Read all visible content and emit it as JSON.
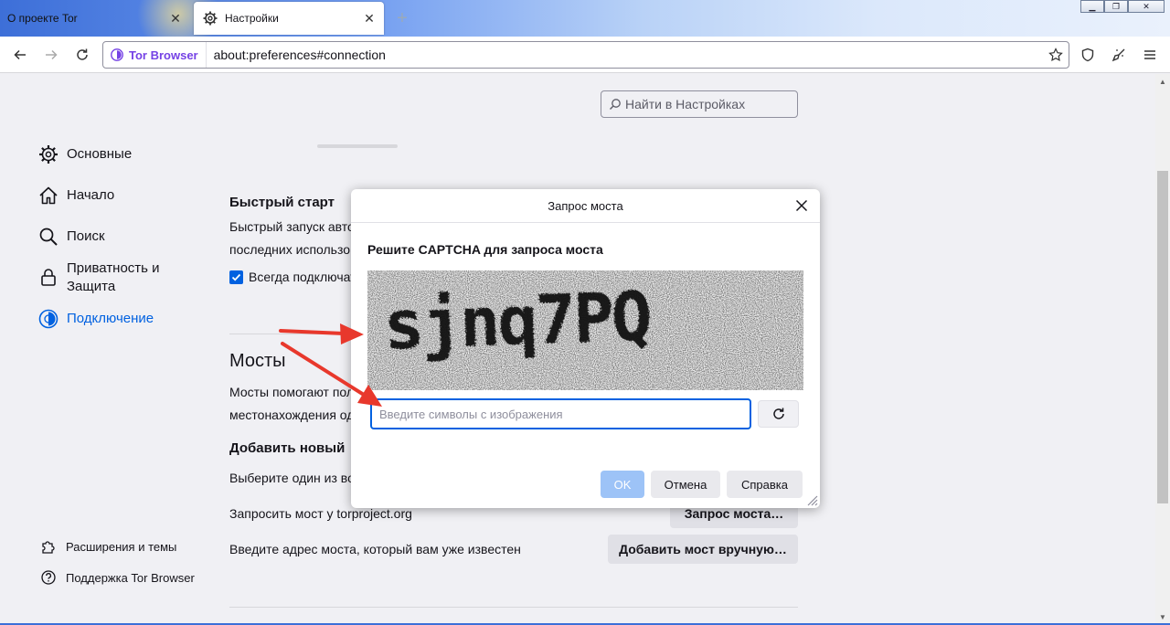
{
  "tabs": [
    {
      "title": "О проекте Tor",
      "active": false
    },
    {
      "title": "Настройки",
      "active": true
    }
  ],
  "navbar": {
    "identity_label": "Tor Browser",
    "url": "about:preferences#connection"
  },
  "search": {
    "placeholder": "Найти в Настройках"
  },
  "sidebar": {
    "items": [
      {
        "label": "Основные",
        "icon": "gear-icon"
      },
      {
        "label": "Начало",
        "icon": "home-icon"
      },
      {
        "label": "Поиск",
        "icon": "search-icon"
      },
      {
        "label": "Приватность и Защита",
        "icon": "lock-icon"
      },
      {
        "label": "Подключение",
        "icon": "tor-connection-icon",
        "selected": true
      }
    ],
    "footer": [
      {
        "label": "Расширения и темы",
        "icon": "puzzle-icon"
      },
      {
        "label": "Поддержка Tor Browser",
        "icon": "help-icon"
      }
    ]
  },
  "content": {
    "quickstart": {
      "title": "Быстрый старт",
      "desc_line1": "Быстрый запуск авто",
      "desc_line2": "последних использо",
      "checkbox_label": "Всегда подключат",
      "checked": true
    },
    "bridges": {
      "title": "Мосты",
      "desc_line1": "Мосты помогают пол",
      "desc_line2": "местонахождения од",
      "add_title": "Добавить новый",
      "choose_text": "Выберите один из во",
      "request_text": "Запросить мост у torproject.org",
      "request_button": "Запрос моста…",
      "manual_text": "Введите адрес моста, который вам уже известен",
      "manual_button": "Добавить мост вручную…"
    }
  },
  "dialog": {
    "title": "Запрос моста",
    "heading": "Решите CAPTCHA для запроса моста",
    "captcha_text": "sjnq7PQ",
    "input_placeholder": "Введите символы с изображения",
    "buttons": {
      "ok": "OK",
      "cancel": "Отмена",
      "help": "Справка"
    }
  },
  "colors": {
    "accent": "#0061e0",
    "tor_purple": "#7542e5",
    "annotation_arrow": "#e8382c"
  }
}
